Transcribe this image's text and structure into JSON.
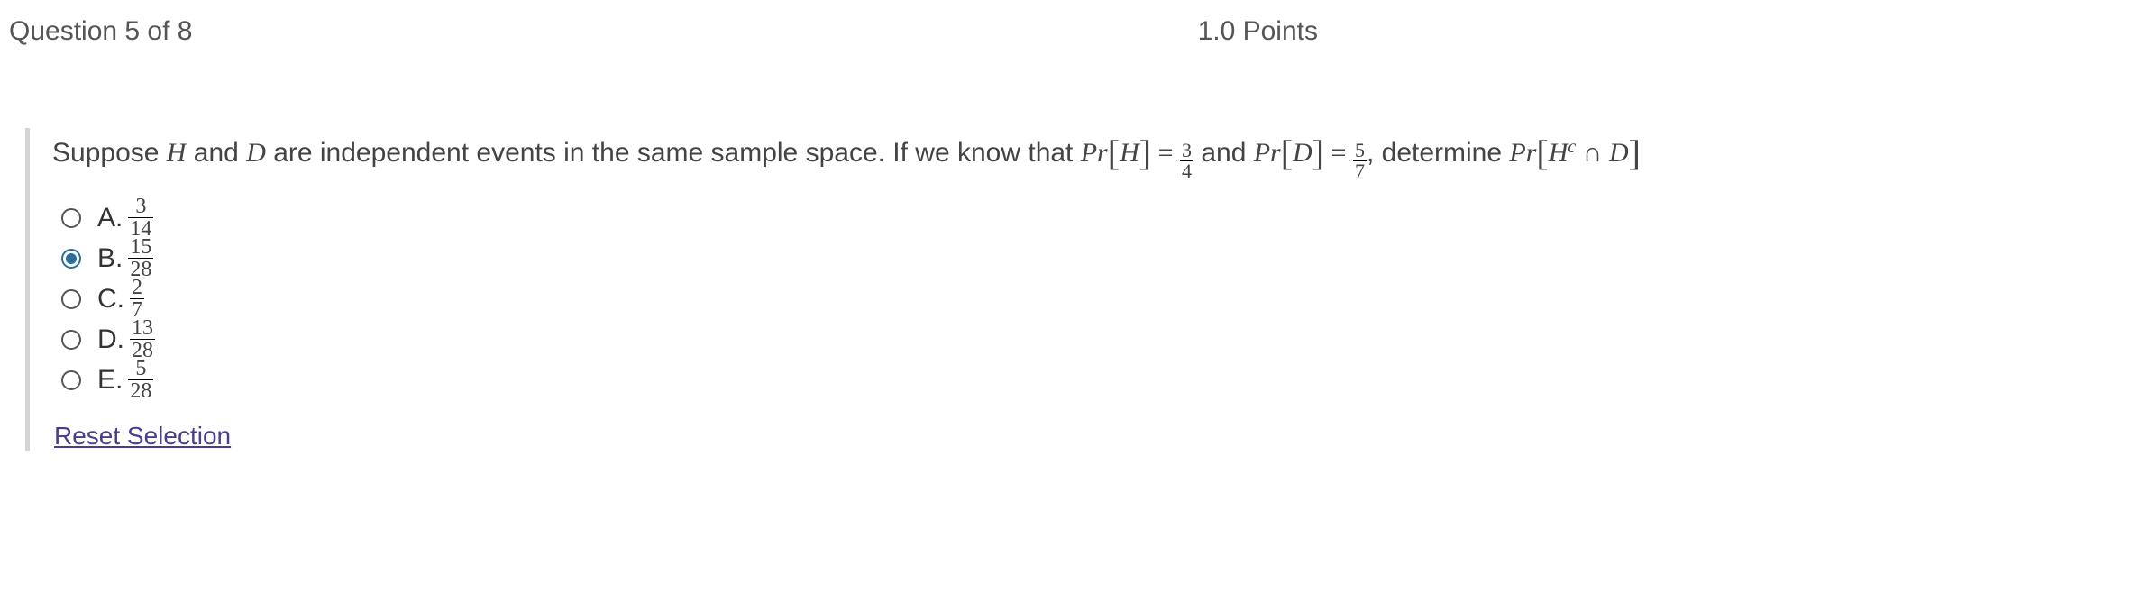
{
  "header": {
    "question_label": "Question 5 of 8",
    "points": "1.0 Points"
  },
  "prompt": {
    "t1": "Suppose ",
    "v1": "H",
    "t2": " and ",
    "v2": "D",
    "t3": " are independent events in the same sample space. If we know that ",
    "pr": "Pr",
    "eq": " = ",
    "f1n": "3",
    "f1d": "4",
    "and": " and ",
    "f2n": "5",
    "f2d": "7",
    "t4": ", determine ",
    "sup": "c",
    "cap": " ∩ "
  },
  "options": [
    {
      "label": "A.",
      "num": "3",
      "den": "14",
      "selected": false
    },
    {
      "label": "B.",
      "num": "15",
      "den": "28",
      "selected": true
    },
    {
      "label": "C.",
      "num": "2",
      "den": "7",
      "selected": false
    },
    {
      "label": "D.",
      "num": "13",
      "den": "28",
      "selected": false
    },
    {
      "label": "E.",
      "num": "5",
      "den": "28",
      "selected": false
    }
  ],
  "reset": "Reset Selection"
}
